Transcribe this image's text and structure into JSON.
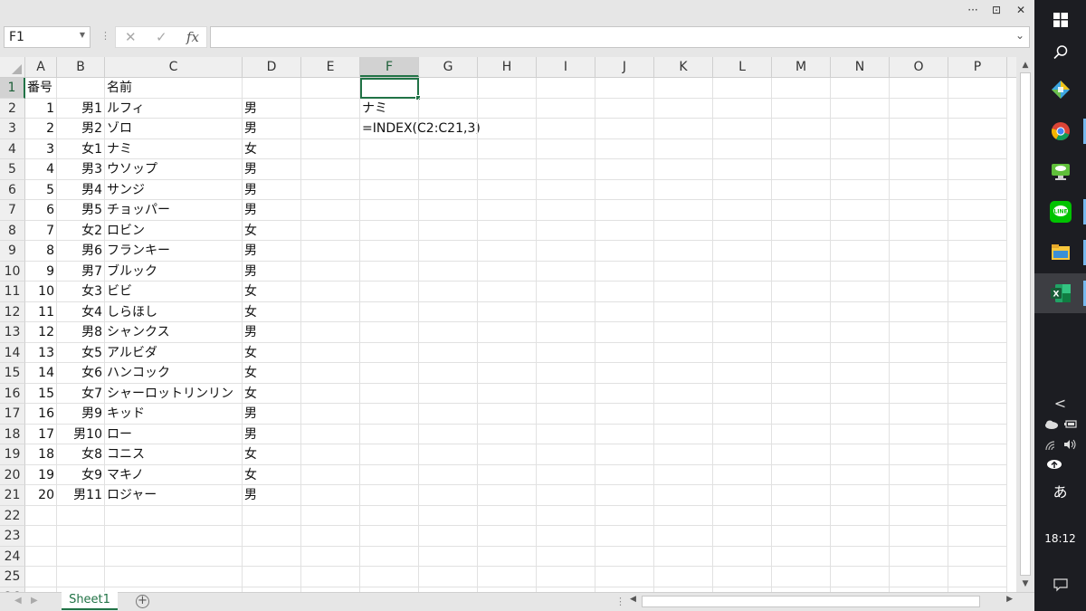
{
  "window": {
    "title_buttons": [
      "···",
      "⊡",
      "✕"
    ]
  },
  "formula_bar": {
    "name_box": "F1",
    "formula": "",
    "fx_label": "fx"
  },
  "columns": [
    "A",
    "B",
    "C",
    "D",
    "E",
    "F",
    "G",
    "H",
    "I",
    "J",
    "K",
    "L",
    "M",
    "N",
    "O",
    "P"
  ],
  "selected_column": "F",
  "selected_row": "1",
  "rows": [
    {
      "num": "1",
      "A": "番号",
      "B": "",
      "C": "名前",
      "D": "",
      "F": ""
    },
    {
      "num": "2",
      "A": "1",
      "B": "男1",
      "C": "ルフィ",
      "D": "男",
      "F": "ナミ"
    },
    {
      "num": "3",
      "A": "2",
      "B": "男2",
      "C": "ゾロ",
      "D": "男",
      "F": "=INDEX(C2:C21,3)"
    },
    {
      "num": "4",
      "A": "3",
      "B": "女1",
      "C": "ナミ",
      "D": "女",
      "F": ""
    },
    {
      "num": "5",
      "A": "4",
      "B": "男3",
      "C": "ウソップ",
      "D": "男",
      "F": ""
    },
    {
      "num": "6",
      "A": "5",
      "B": "男4",
      "C": "サンジ",
      "D": "男",
      "F": ""
    },
    {
      "num": "7",
      "A": "6",
      "B": "男5",
      "C": "チョッパー",
      "D": "男",
      "F": ""
    },
    {
      "num": "8",
      "A": "7",
      "B": "女2",
      "C": "ロビン",
      "D": "女",
      "F": ""
    },
    {
      "num": "9",
      "A": "8",
      "B": "男6",
      "C": "フランキー",
      "D": "男",
      "F": ""
    },
    {
      "num": "10",
      "A": "9",
      "B": "男7",
      "C": "ブルック",
      "D": "男",
      "F": ""
    },
    {
      "num": "11",
      "A": "10",
      "B": "女3",
      "C": "ビビ",
      "D": "女",
      "F": ""
    },
    {
      "num": "12",
      "A": "11",
      "B": "女4",
      "C": "しらほし",
      "D": "女",
      "F": ""
    },
    {
      "num": "13",
      "A": "12",
      "B": "男8",
      "C": "シャンクス",
      "D": "男",
      "F": ""
    },
    {
      "num": "14",
      "A": "13",
      "B": "女5",
      "C": "アルビダ",
      "D": "女",
      "F": ""
    },
    {
      "num": "15",
      "A": "14",
      "B": "女6",
      "C": "ハンコック",
      "D": "女",
      "F": ""
    },
    {
      "num": "16",
      "A": "15",
      "B": "女7",
      "C": "シャーロットリンリン",
      "D": "女",
      "F": ""
    },
    {
      "num": "17",
      "A": "16",
      "B": "男9",
      "C": "キッド",
      "D": "男",
      "F": ""
    },
    {
      "num": "18",
      "A": "17",
      "B": "男10",
      "C": "ロー",
      "D": "男",
      "F": ""
    },
    {
      "num": "19",
      "A": "18",
      "B": "女8",
      "C": "コニス",
      "D": "女",
      "F": ""
    },
    {
      "num": "20",
      "A": "19",
      "B": "女9",
      "C": "マキノ",
      "D": "女",
      "F": ""
    },
    {
      "num": "21",
      "A": "20",
      "B": "男11",
      "C": "ロジャー",
      "D": "男",
      "F": ""
    },
    {
      "num": "22",
      "A": "",
      "B": "",
      "C": "",
      "D": "",
      "F": ""
    },
    {
      "num": "23",
      "A": "",
      "B": "",
      "C": "",
      "D": "",
      "F": ""
    },
    {
      "num": "24",
      "A": "",
      "B": "",
      "C": "",
      "D": "",
      "F": ""
    },
    {
      "num": "25",
      "A": "",
      "B": "",
      "C": "",
      "D": "",
      "F": ""
    },
    {
      "num": "26",
      "A": "",
      "B": "",
      "C": "",
      "D": "",
      "F": ""
    }
  ],
  "sheet_tabs": [
    {
      "label": "Sheet1",
      "active": true
    }
  ],
  "taskbar": {
    "icons": [
      "windows-start-icon",
      "search-icon",
      "app-icon",
      "chrome-icon",
      "remote-desktop-icon",
      "line-icon",
      "file-explorer-icon",
      "excel-icon"
    ],
    "tray_chevron": "<",
    "ime": "あ",
    "clock": "18:12"
  },
  "colors": {
    "excel_green": "#217346",
    "taskbar_bg": "#1c1d22"
  }
}
